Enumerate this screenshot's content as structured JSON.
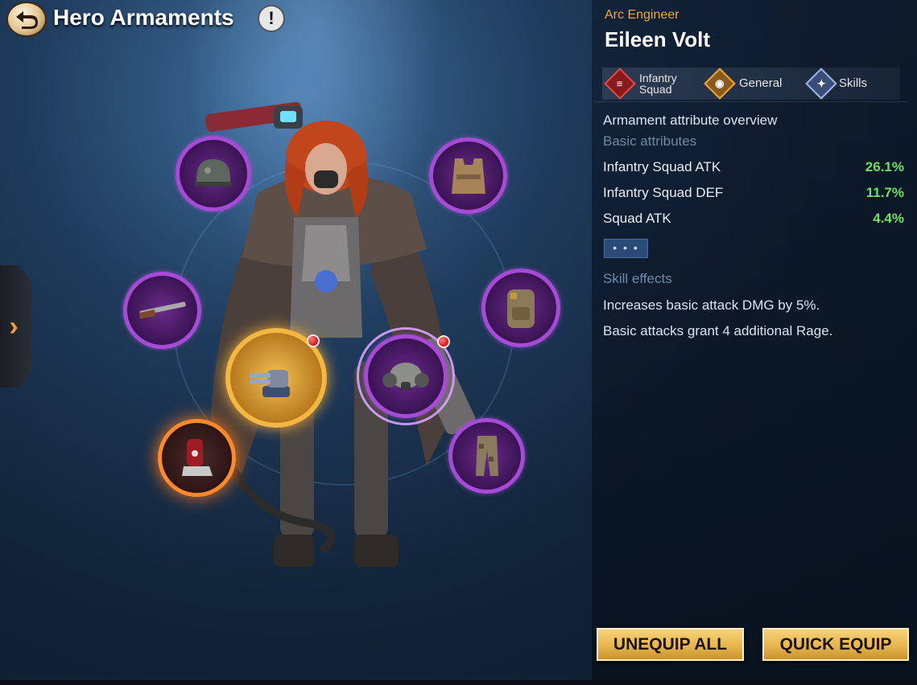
{
  "header": {
    "title": "Hero Armaments",
    "info_label": "!"
  },
  "side_tab": {
    "label": "›"
  },
  "hero": {
    "class": "Arc Engineer",
    "name": "Eileen Volt"
  },
  "tabs": [
    {
      "label": "Infantry Squad",
      "icon": "infantry-squad-icon"
    },
    {
      "label": "General",
      "icon": "general-icon"
    },
    {
      "label": "Skills",
      "icon": "skills-icon"
    }
  ],
  "attributes": {
    "overview_heading": "Armament attribute overview",
    "basic_heading": "Basic attributes",
    "rows": [
      {
        "label": "Infantry Squad ATK",
        "value": "26.1%"
      },
      {
        "label": "Infantry Squad DEF",
        "value": "11.7%"
      },
      {
        "label": "Squad ATK",
        "value": "4.4%"
      }
    ],
    "more_label": "• • •"
  },
  "skill_effects": {
    "heading": "Skill effects",
    "lines": [
      "Increases basic attack DMG by 5%.",
      "Basic attacks grant 4 additional Rage."
    ]
  },
  "buttons": {
    "unequip_all": "UNEQUIP ALL",
    "quick_equip": "QUICK EQUIP"
  },
  "equipment_slots": [
    {
      "item": "helmet",
      "rarity": "purple"
    },
    {
      "item": "body-armor-vest",
      "rarity": "purple"
    },
    {
      "item": "shotgun",
      "rarity": "purple"
    },
    {
      "item": "backpack",
      "rarity": "purple"
    },
    {
      "item": "turret-cannon",
      "rarity": "gold",
      "alert": true
    },
    {
      "item": "gas-mask",
      "rarity": "purple",
      "alert": true
    },
    {
      "item": "spiked-boots",
      "rarity": "orange"
    },
    {
      "item": "camo-pants",
      "rarity": "purple"
    }
  ],
  "colors": {
    "accent_orange": "#f0a83a",
    "positive_green": "#6ee060",
    "button_gold": "#e7b64e",
    "rarity_purple": "#a54bd6",
    "rarity_gold": "#f3b742"
  }
}
